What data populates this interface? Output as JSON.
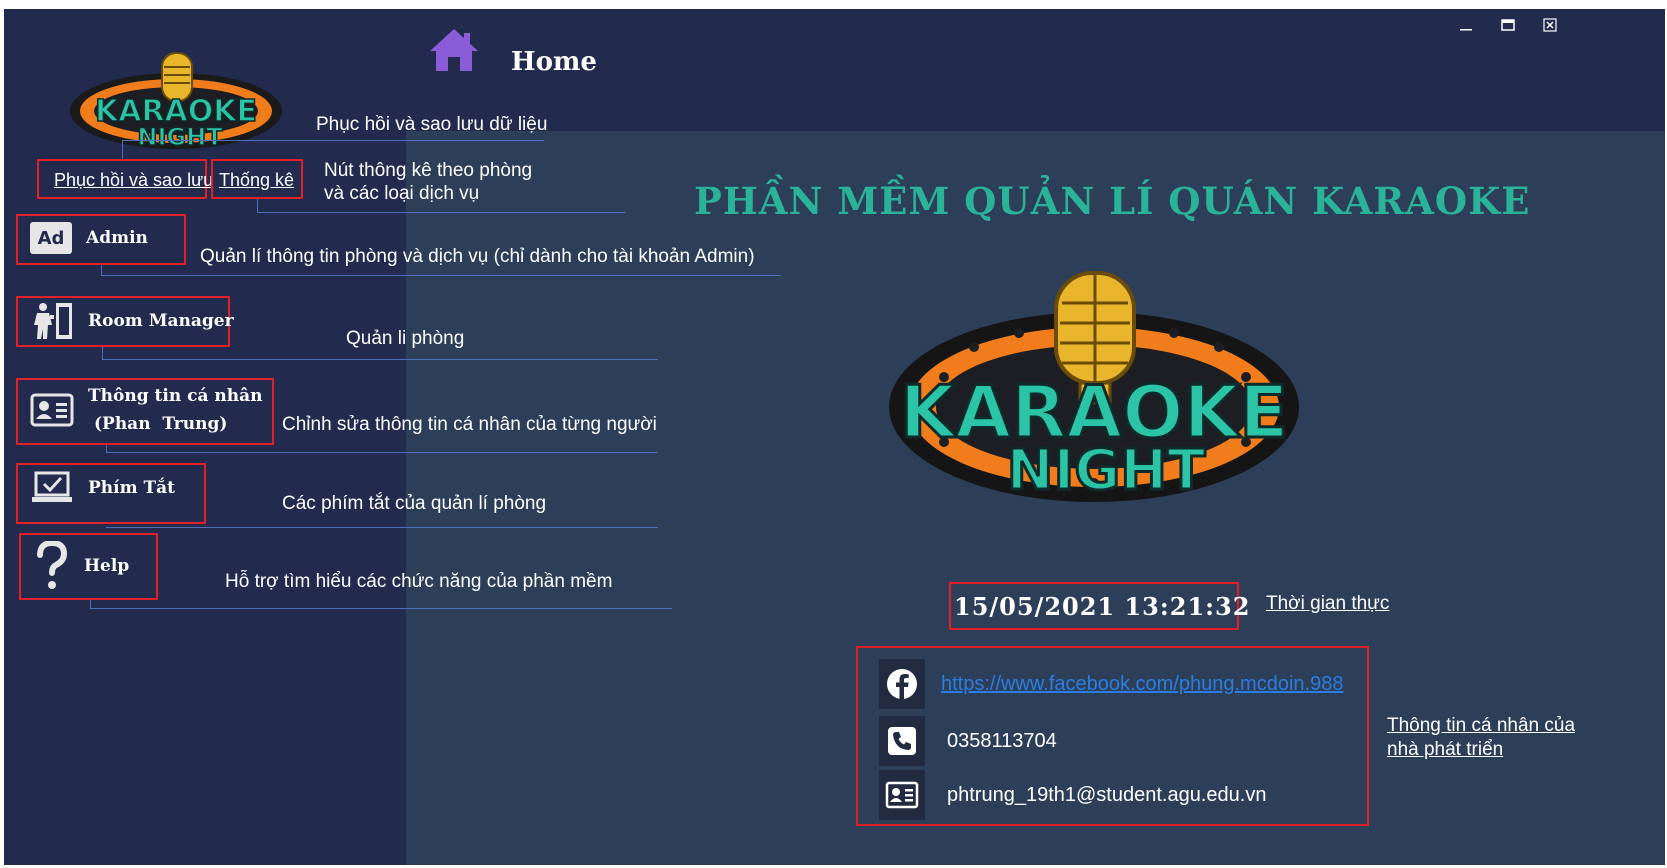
{
  "header": {
    "title": "Home",
    "home_icon": "home-icon"
  },
  "window_controls": {
    "minimize": "‒",
    "maximize": "▭",
    "close": "✕"
  },
  "links": {
    "restore_backup": "Phục hồi và sao lưu",
    "statistics": "Thống kê"
  },
  "menu": [
    {
      "key": "admin",
      "label": "Admin",
      "icon": "admin-icon",
      "icon_text": "Ad"
    },
    {
      "key": "room-manager",
      "label": "Room Manager",
      "icon": "room-manager-icon"
    },
    {
      "key": "profile",
      "label_line1": "Thông tin cá nhân",
      "label_line2": "(Phan  Trung)",
      "icon": "id-card-icon"
    },
    {
      "key": "shortcuts",
      "label": "Phím Tắt",
      "icon": "laptop-check-icon"
    },
    {
      "key": "help",
      "label": "Help",
      "icon": "question-icon"
    }
  ],
  "annotations": {
    "restore_backup": "Phục hồi và sao lưu dữ liệu",
    "statistics_line1": "Nút thông kê theo phòng",
    "statistics_line2": "và các loại dịch vụ",
    "admin": "Quản lí thông tin phòng và dịch vụ (chỉ dành cho tài khoản Admin)",
    "room_manager": "Quản li phòng",
    "profile": "Chỉnh sửa thông tin cá nhân của từng người",
    "shortcuts": "Các phím tắt của quản lí phòng",
    "help": "Hỗ trợ  tìm hiểu các chức năng của phần mềm",
    "clock": "Thời gian thực",
    "developer_line1": "Thông tin cá nhân của",
    "developer_line2": "nhà phát triển"
  },
  "main": {
    "title": "PHẦN MỀM QUẢN LÍ QUÁN KARAOKE",
    "logo_text": {
      "line1": "KARAOKE",
      "line2": "NIGHT"
    },
    "clock": "15/05/2021 13:21:32"
  },
  "contact": {
    "facebook": "https://www.facebook.com/phung.mcdoin.988",
    "phone": "0358113704",
    "email": "phtrung_19th1@student.agu.edu.vn"
  },
  "colors": {
    "accent_teal": "#2bb39a",
    "highlight_red": "#e01f26",
    "sidebar": "#222a4e",
    "content": "#2c3e58",
    "link_blue": "#2b7de0",
    "annotation_line": "#4a6fb8"
  }
}
